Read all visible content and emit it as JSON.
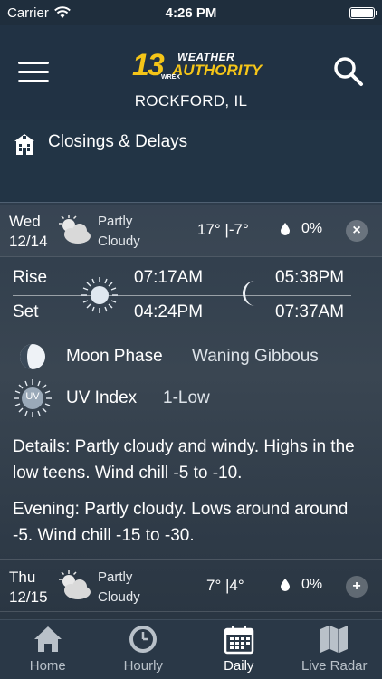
{
  "status_bar": {
    "carrier": "Carrier",
    "time": "4:26 PM"
  },
  "header": {
    "logo": {
      "number": "13",
      "line1": "WEATHER",
      "line2": "AUTHORITY",
      "station": "WREX"
    },
    "location": "ROCKFORD, IL"
  },
  "closings": {
    "label": "Closings & Delays"
  },
  "days": [
    {
      "day": "Wed",
      "date": "12/14",
      "condition_line1": "Partly",
      "condition_line2": "Cloudy",
      "temps": "17° |-7°",
      "precip": "0%",
      "toggle": "×"
    },
    {
      "day": "Thu",
      "date": "12/15",
      "condition_line1": "Partly",
      "condition_line2": "Cloudy",
      "temps": "7° |4°",
      "precip": "0%",
      "toggle": "+"
    }
  ],
  "details": {
    "rise_label": "Rise",
    "set_label": "Set",
    "sunrise": "07:17AM",
    "sunset": "04:24PM",
    "moonrise": "05:38PM",
    "moonset": "07:37AM",
    "moon_phase_label": "Moon Phase",
    "moon_phase_value": "Waning Gibbous",
    "uv_label": "UV Index",
    "uv_value": "1-Low",
    "uv_badge": "UV",
    "details_text": "Details: Partly cloudy and windy. Highs in the low teens. Wind chill -5 to -10.",
    "evening_text": "Evening: Partly cloudy. Lows around around -5. Wind chill -15 to -30."
  },
  "tabs": [
    {
      "label": "Home",
      "icon": "home-icon"
    },
    {
      "label": "Hourly",
      "icon": "clock-icon"
    },
    {
      "label": "Daily",
      "icon": "calendar-icon"
    },
    {
      "label": "Live Radar",
      "icon": "map-icon"
    }
  ],
  "active_tab": "Daily"
}
